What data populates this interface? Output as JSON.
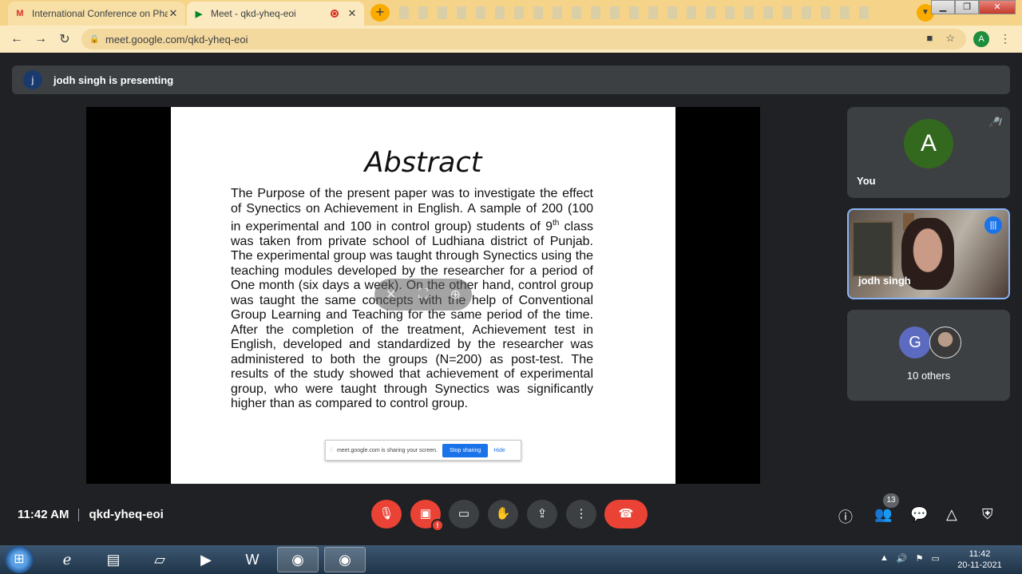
{
  "browser": {
    "tabs": [
      {
        "title": "International Conference on Pha",
        "favicon": "gmail-icon"
      },
      {
        "title": "Meet - qkd-yheq-eoi",
        "favicon": "meet-icon"
      }
    ],
    "url": "meet.google.com/qkd-yheq-eoi",
    "profile_initial": "A"
  },
  "meet": {
    "presenter_initial": "j",
    "presenting_text": "jodh singh is presenting",
    "slide": {
      "title": "Abstract",
      "body_pre": "The Purpose of the present paper was to investigate the effect of Synectics on Achievement in English. A sample of 200 (100 in experimental and 100 in control group) students of 9",
      "body_sup": "th",
      "body_post": " class was taken from private school of Ludhiana district of Punjab. The experimental group was taught through Synectics using the teaching modules developed by the researcher for a period of One month (six days a week). On the other hand, control group was taught the same concepts with the help of Conventional Group Learning and Teaching for the same period of the time. After the completion of the treatment, Achievement test in English, developed and standardized by the researcher was administered to both the groups (N=200) as post-test. The results of the study showed that achievement of experimental group, who were taught through Synectics was significantly higher than as compared to control group."
    },
    "share_banner": {
      "text": "meet.google.com is sharing your screen.",
      "stop_label": "Stop sharing",
      "hide_label": "Hide"
    },
    "participants": {
      "you": {
        "initial": "A",
        "name": "You"
      },
      "presenter": {
        "name": "jodh singh"
      },
      "others": {
        "initial": "G",
        "label": "10 others"
      }
    },
    "time": "11:42 AM",
    "meeting_code": "qkd-yheq-eoi",
    "people_count": "13"
  },
  "taskbar": {
    "clock_time": "11:42",
    "clock_date": "20-11-2021"
  }
}
